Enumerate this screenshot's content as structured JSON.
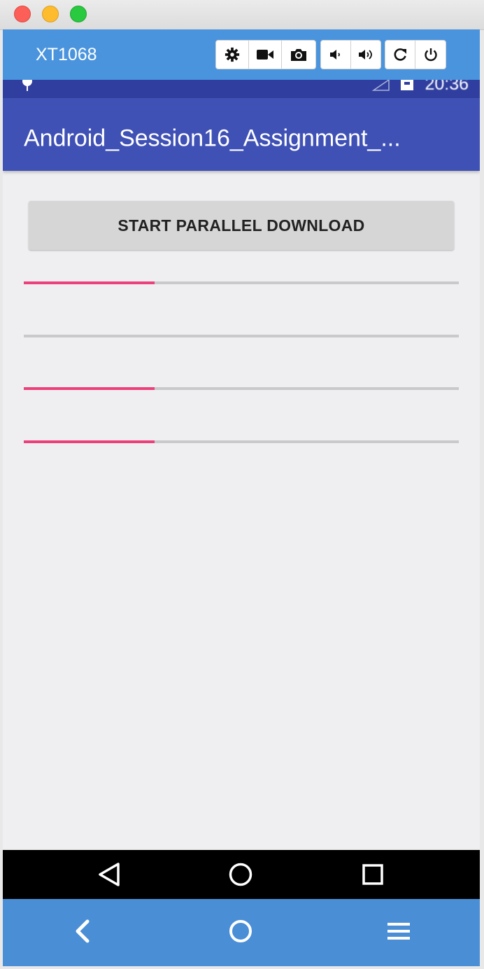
{
  "window": {
    "device_name": "XT1068",
    "toolbar_icons": [
      "gear-icon",
      "video-camera-icon",
      "camera-icon",
      "volume-down-icon",
      "volume-up-icon",
      "rotate-icon",
      "power-icon"
    ]
  },
  "statusbar": {
    "time": "20:36"
  },
  "app": {
    "title": "Android_Session16_Assignment_...",
    "start_button_label": "START PARALLEL DOWNLOAD",
    "progress": [
      0.3,
      0.0,
      0.3,
      0.3
    ],
    "accent_color": "#ec407a",
    "primary_color": "#3f51b5",
    "primary_dark_color": "#303f9f"
  },
  "navbar_icons": [
    "back-triangle-icon",
    "home-circle-icon",
    "recents-square-icon"
  ],
  "bottombar_icons": [
    "chevron-left-icon",
    "circle-home-icon",
    "menu-icon"
  ]
}
